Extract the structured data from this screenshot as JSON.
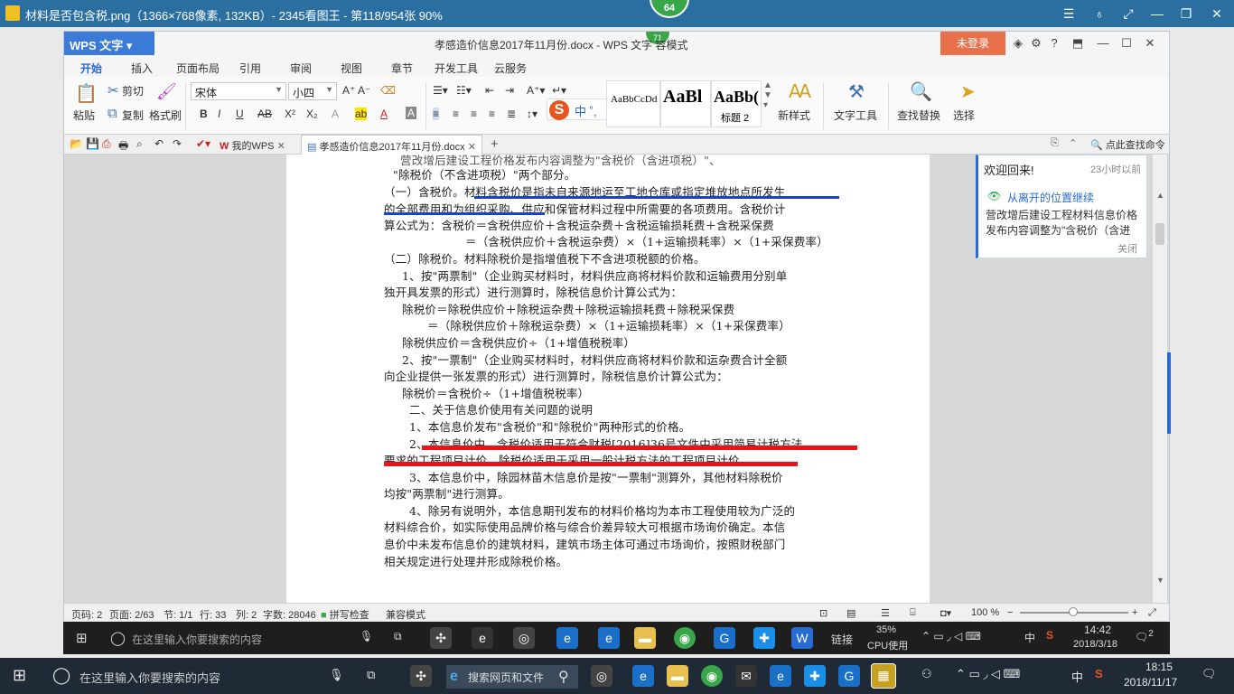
{
  "viewer": {
    "title": "材料是否包含税.png（1366×768像素, 132KB）- 2345看图王 - 第118/954张 90%",
    "badge_top": "64"
  },
  "wps": {
    "logo": "WPS 文字",
    "title": "孝感造价信息2017年11月份.docx - WPS 文字",
    "title_suffix": "容模式",
    "badge": "71",
    "login": "未登录",
    "tabs": [
      "开始",
      "插入",
      "页面布局",
      "引用",
      "审阅",
      "视图",
      "章节",
      "开发工具",
      "云服务"
    ],
    "ribbon": {
      "paste": "粘贴",
      "cut": "剪切",
      "copy": "复制",
      "format_painter": "格式刷",
      "font_name": "宋体",
      "font_size": "小四",
      "styles": [
        "AaBbCcDd",
        "AaBl",
        "AaBb("
      ],
      "heading2": "标题 2",
      "new_style": "新样式",
      "text_tools": "文字工具",
      "find_replace": "查找替换",
      "select": "选择"
    },
    "quickbar": {
      "mywps": "我的WPS",
      "doc_tab": "孝感造价信息2017年11月份.docx",
      "search_cmd": "点此查找命令"
    }
  },
  "document": {
    "lines": [
      "营改增后建设工程价格发布内容调整为\"含税价（含进项税）\"、",
      "\"除税价（不含进项税）\"两个部分。",
      "（一）含税价。材料含税价是指未自来源地运至工地仓库或指定堆放地点所发生",
      "的全部费用和为组织采购、供应和保管材料过程中所需要的各项费用。含税价计",
      "算公式为：含税价＝含税供应价＋含税运杂费＋含税运输损耗费＋含税采保费",
      "＝（含税供应价＋含税运杂费）×（1+运输损耗率）×（1+采保费率）",
      "（二）除税价。材料除税价是指增值税下不含进项税额的价格。",
      "1、按\"两票制\"（企业购买材料时，材料供应商将材料价款和运输费用分别单",
      "独开具发票的形式）进行测算时，除税信息价计算公式为：",
      "除税价＝除税供应价＋除税运杂费＋除税运输损耗费＋除税采保费",
      "＝（除税供应价＋除税运杂费）×（1+运输损耗率）×（1+采保费率）",
      "除税供应价＝含税供应价÷（1+增值税税率）",
      "2、按\"一票制\"（企业购买材料时，材料供应商将材料价款和运杂费合计全额",
      "向企业提供一张发票的形式）进行测算时，除税信息价计算公式为：",
      "除税价＝含税价÷（1+增值税税率）",
      "二、关于信息价使用有关问题的说明",
      "1、本信息价发布\"含税价\"和\"除税价\"两种形式的价格。",
      "2、本信息价中，含税价适用于符合财税[2016]36号文件中采用简易计税方法",
      "要求的工程项目计价，除税价适用于采用一般计税方法的工程项目计价。",
      "3、本信息价中，除园林苗木信息价是按\"一票制\"测算外，其他材料除税价",
      "均按\"两票制\"进行测算。",
      "4、除另有说明外，本信息期刊发布的材料价格均为本市工程使用较为广泛的",
      "材料综合价，如实际使用品牌价格与综合价差异较大可根据市场询价确定。本信",
      "息价中未发布信息价的建筑材料，建筑市场主体可通过市场询价，按照财税部门",
      "相关规定进行处理并形成除税价格。"
    ]
  },
  "side_panel": {
    "welcome": "欢迎回来!",
    "time": "23小时以前",
    "continue": "从离开的位置继续",
    "preview": "营改增后建设工程材料信息价格发布内容调整为\"含税价（含进",
    "close": "关闭"
  },
  "status": {
    "page": "页码: 2",
    "pages": "页面: 2/63",
    "section": "节: 1/1",
    "row": "行: 33",
    "col": "列: 2",
    "words": "字数: 28046",
    "spell": "拼写检查",
    "compat": "兼容模式",
    "zoom": "100 %"
  },
  "inner_taskbar": {
    "search": "在这里输入你要搜索的内容",
    "link": "链接",
    "cpu_pct": "35%",
    "cpu_label": "CPU使用",
    "ime": "中",
    "time": "14:42",
    "date": "2018/3/18",
    "notif": "2"
  },
  "taskbar": {
    "search": "在这里输入你要搜索的内容",
    "browser_search": "搜索网页和文件",
    "ime": "中",
    "time": "18:15",
    "date": "2018/11/17"
  }
}
